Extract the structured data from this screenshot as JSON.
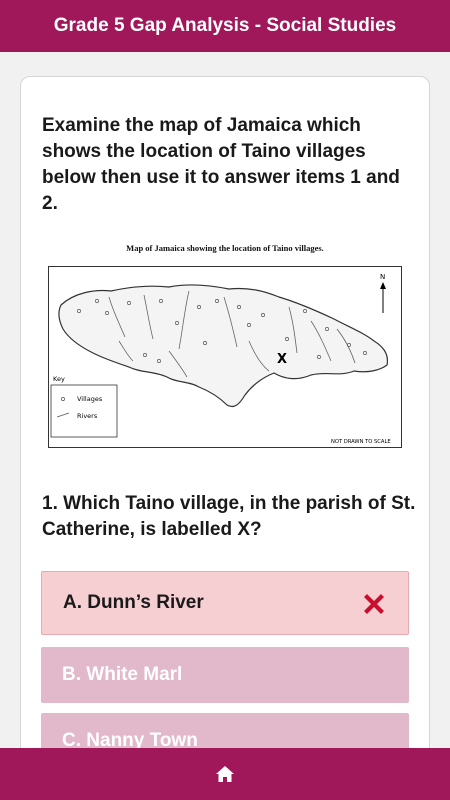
{
  "header": {
    "title": "Grade 5 Gap Analysis - Social Studies"
  },
  "instruction": "Examine the map of Jamaica which shows the location of Taino villages below then use it to answer items 1 and 2.",
  "map": {
    "caption": "Map of Jamaica showing the location of Taino villages.",
    "north_label": "N",
    "marker_label": "X",
    "key_title": "Key",
    "key_items": [
      "Villages",
      "Rivers"
    ],
    "scale_note": "NOT DRAWN TO SCALE"
  },
  "question": "1. Which Taino village, in the parish of St. Catherine, is labelled X?",
  "options": [
    {
      "label": "A. Dunn’s River",
      "state": "wrong"
    },
    {
      "label": "B. White Marl",
      "state": "neutral"
    },
    {
      "label": "C. Nanny Town",
      "state": "neutral"
    }
  ],
  "colors": {
    "brand": "#a0185a",
    "wrong_bg": "#f6cfd3",
    "option_bg": "#e2b8cb",
    "wrong_icon": "#c8102e"
  },
  "icons": {
    "wrong": "x-mark-icon",
    "home": "home-icon"
  }
}
